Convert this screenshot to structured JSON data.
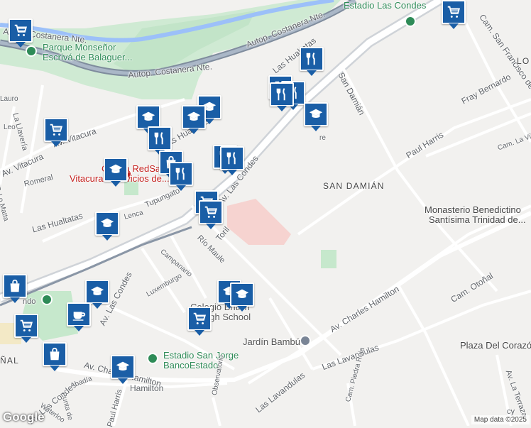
{
  "labels": {
    "estadio_las_condes": "Estadio Las Condes",
    "autop_costanera_a": "Autop. Costanera Nte.",
    "autop_costanera_b": "Autop. Costanera Nte.",
    "autop_costanera_c": "Autop. Costanera Nte.",
    "parque_1": "Parque Monseñor",
    "parque_2": "Escrivá de Balaguer...",
    "las_hualtatas_top": "Las Hualtatas",
    "san_damian_st": "San Damián",
    "cam_san_francisco": "Cam. San Francisco de Asís",
    "fray_bernardo": "Fray Bernardo",
    "cam_la_vina": "Cam. La Viña",
    "lo": "LO",
    "paul_harris": "Paul Harris",
    "san_damian_area": "SAN DAMIÁN",
    "monasterio_1": "Monasterio Benedictino",
    "monasterio_2": "Santísima Trinidad de...",
    "av_vitacura": "Av. Vitacura",
    "av_vitacura2": "Av. Vitacura",
    "la_llavería": "La Llavería",
    "romeral": "Romeral",
    "leo": "Leo",
    "lauro": "Lauro",
    "p_lo_matta": "P. Lo Matta",
    "las_hualtatas_mid": "Las Hualtatas",
    "las_hualtatas_left": "Las Hualtatas",
    "lenca": "Lenca",
    "tupungato": "Tupungato",
    "av_las_condes": "Av. Las Condes",
    "av_las_condes2": "Av. Las Condes",
    "av_las_condes3": "Av. Las Condes",
    "clinica_1": "Clínica RedSalud",
    "clinica_2": "Vitacura - Servicios de...",
    "rio_maule": "Río Maule",
    "campanario": "Campanario",
    "luxemburgo": "Luxemburgo",
    "colegio_1": "Colegio British",
    "colegio_2": "High School",
    "av_charles": "Av. Charles Hamilton",
    "av_charles2": "Av. Charles Hamilton",
    "hamilton": "Hamilton",
    "jardin_bambu": "Jardín Bambú",
    "estadio_sj_1": "Estadio San Jorge",
    "estadio_sj_2": "BancoEstado",
    "las_lavandulas": "Las Lavandulas",
    "las_lavandulas2": "Las Lavandulas",
    "cam_otonal": "Cam. Otoñal",
    "plaza_corazon": "Plaza Del Corazón",
    "cam_piedra_roja": "Cam. Piedra Roja",
    "paul_harris2": "Paul Harris",
    "abadia": "Abadía",
    "punta_de": "Punta de",
    "waterloo": "Waterloo",
    "observatorio": "Observatorio",
    "nal": "ÑAL",
    "ndo": "ndo",
    "av_la_terraza": "Av. La Terraza",
    "cy": "cy",
    "re": "re",
    "toril": "Toril"
  },
  "markers": [
    {
      "type": "shopping-cart",
      "icon": "shopping-cart-icon"
    },
    {
      "type": "shopping-cart",
      "icon": "shopping-cart-icon"
    },
    {
      "type": "shopping-cart",
      "icon": "shopping-cart-icon"
    },
    {
      "type": "restaurant",
      "icon": "fork-knife-icon"
    },
    {
      "type": "restaurant",
      "icon": "fork-knife-icon"
    },
    {
      "type": "restaurant",
      "icon": "fork-knife-icon"
    },
    {
      "type": "restaurant",
      "icon": "fork-knife-icon"
    },
    {
      "type": "school",
      "icon": "graduation-cap-icon"
    },
    {
      "type": "school",
      "icon": "graduation-cap-icon"
    },
    {
      "type": "school",
      "icon": "graduation-cap-icon"
    },
    {
      "type": "school",
      "icon": "graduation-cap-icon"
    },
    {
      "type": "restaurant",
      "icon": "fork-knife-icon"
    },
    {
      "type": "shopping-bag",
      "icon": "shopping-bag-icon"
    },
    {
      "type": "restaurant",
      "icon": "fork-knife-icon"
    },
    {
      "type": "restaurant",
      "icon": "fork-knife-icon"
    },
    {
      "type": "restaurant",
      "icon": "fork-knife-icon"
    },
    {
      "type": "school",
      "icon": "graduation-cap-icon"
    },
    {
      "type": "shopping-cart",
      "icon": "shopping-cart-icon"
    },
    {
      "type": "shopping-cart",
      "icon": "shopping-cart-icon"
    },
    {
      "type": "school",
      "icon": "graduation-cap-icon"
    },
    {
      "type": "shopping-bag",
      "icon": "shopping-bag-icon"
    },
    {
      "type": "school",
      "icon": "graduation-cap-icon"
    },
    {
      "type": "cafe",
      "icon": "coffee-cup-icon"
    },
    {
      "type": "shopping-cart",
      "icon": "shopping-cart-icon"
    },
    {
      "type": "shopping-bag",
      "icon": "shopping-bag-icon"
    },
    {
      "type": "school",
      "icon": "graduation-cap-icon"
    },
    {
      "type": "school",
      "icon": "graduation-cap-icon"
    },
    {
      "type": "shopping-cart",
      "icon": "shopping-cart-icon"
    },
    {
      "type": "school",
      "icon": "graduation-cap-icon"
    }
  ],
  "attribution": "Map data ©2025",
  "logo": "Google",
  "colors": {
    "marker": "#1a5ea6",
    "park": "#b9e4c0",
    "water": "#9cc0f9",
    "highway": "#f8d08a"
  }
}
